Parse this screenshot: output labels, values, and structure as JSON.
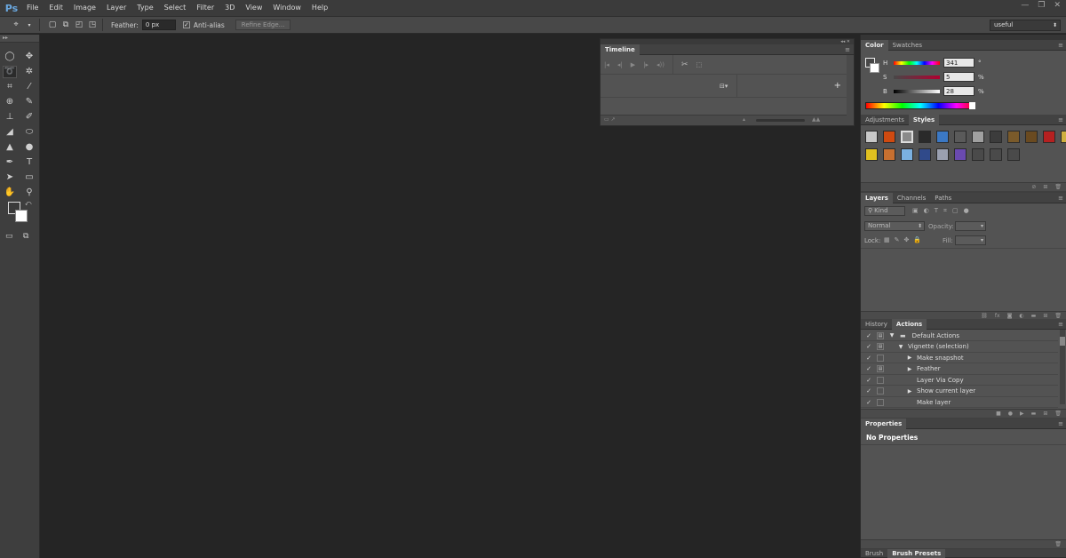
{
  "menu": {
    "logo": "Ps",
    "items": [
      "File",
      "Edit",
      "Image",
      "Layer",
      "Type",
      "Select",
      "Filter",
      "3D",
      "View",
      "Window",
      "Help"
    ],
    "window_controls": [
      "—",
      "❐",
      "✕"
    ]
  },
  "options": {
    "feather_label": "Feather:",
    "feather_value": "0 px",
    "antialias_label": "Anti-alias",
    "antialias_checked": true,
    "refine_edge_label": "Refine Edge...",
    "workspace_value": "useful"
  },
  "tools": {
    "icons": [
      [
        "marquee-icon",
        "move-icon"
      ],
      [
        "lasso-icon",
        "magic-wand-icon"
      ],
      [
        "crop-icon",
        "eyedropper-icon"
      ],
      [
        "spot-healing-icon",
        "brush-icon"
      ],
      [
        "clone-stamp-icon",
        "history-brush-icon"
      ],
      [
        "eraser-icon",
        "paint-bucket-icon"
      ],
      [
        "blur-icon",
        "dodge-icon"
      ],
      [
        "pen-icon",
        "type-icon"
      ],
      [
        "path-selection-icon",
        "rectangle-shape-icon"
      ],
      [
        "hand-icon",
        "zoom-icon"
      ]
    ],
    "glyphs": [
      [
        "◯",
        "✥"
      ],
      [
        "➰",
        "✲"
      ],
      [
        "⌗",
        "⁄"
      ],
      [
        "⊕",
        "✎"
      ],
      [
        "⊥",
        "✐"
      ],
      [
        "◢",
        "⬭"
      ],
      [
        "▲",
        "●"
      ],
      [
        "✒",
        "T"
      ],
      [
        "➤",
        "▭"
      ],
      [
        "✋",
        "⚲"
      ]
    ]
  },
  "timeline": {
    "tab": "Timeline",
    "controls": [
      "|◂",
      "◂|",
      "▶",
      "|▸",
      "◂))",
      "✂",
      "⬚"
    ],
    "frame_glyph": "⊟▾",
    "add_glyph": "+"
  },
  "color": {
    "tabs": [
      "Color",
      "Swatches"
    ],
    "h_label": "H",
    "h_value": "341",
    "h_unit": "°",
    "s_label": "S",
    "s_value": "5",
    "s_unit": "%",
    "b_label": "B",
    "b_value": "28",
    "b_unit": "%"
  },
  "styles": {
    "tabs": [
      "Adjustments",
      "Styles"
    ],
    "swatch_colors": [
      "#c8c8c8",
      "#d04a10",
      "#8a8a8a",
      "#2a2a2a",
      "#3b78c4",
      "#5a5a5a",
      "#a0a0a0",
      "#3c3c3c",
      "#7a5a2a",
      "#6a4a20",
      "#b52020",
      "#d0b040",
      "#e0c020",
      "#c87030",
      "#7ab0e0",
      "#304a8a",
      "#9aa0b0",
      "#6a4ab0",
      "#4a4a4a",
      "#4a4a4a",
      "#4a4a4a"
    ]
  },
  "layers": {
    "tabs": [
      "Layers",
      "Channels",
      "Paths"
    ],
    "kind_label": "Kind",
    "blend_mode": "Normal",
    "opacity_label": "Opacity:",
    "lock_label": "Lock:",
    "fill_label": "Fill:"
  },
  "actions": {
    "tabs": [
      "History",
      "Actions"
    ],
    "rows": [
      {
        "label": "Default Actions",
        "indent": 0,
        "tri": "▼",
        "folder": true,
        "dialog": true
      },
      {
        "label": "Vignette (selection)",
        "indent": 1,
        "tri": "▼",
        "folder": false,
        "dialog": true
      },
      {
        "label": "Make snapshot",
        "indent": 2,
        "tri": "▶",
        "folder": false,
        "dialog": false
      },
      {
        "label": "Feather",
        "indent": 2,
        "tri": "▶",
        "folder": false,
        "dialog": true
      },
      {
        "label": "Layer Via Copy",
        "indent": 2,
        "tri": "",
        "folder": false,
        "dialog": false
      },
      {
        "label": "Show current layer",
        "indent": 2,
        "tri": "▶",
        "folder": false,
        "dialog": false
      },
      {
        "label": "Make layer",
        "indent": 2,
        "tri": "",
        "folder": false,
        "dialog": false
      }
    ]
  },
  "properties": {
    "tab": "Properties",
    "title": "No Properties"
  },
  "brush": {
    "tabs": [
      "Brush",
      "Brush Presets"
    ]
  }
}
